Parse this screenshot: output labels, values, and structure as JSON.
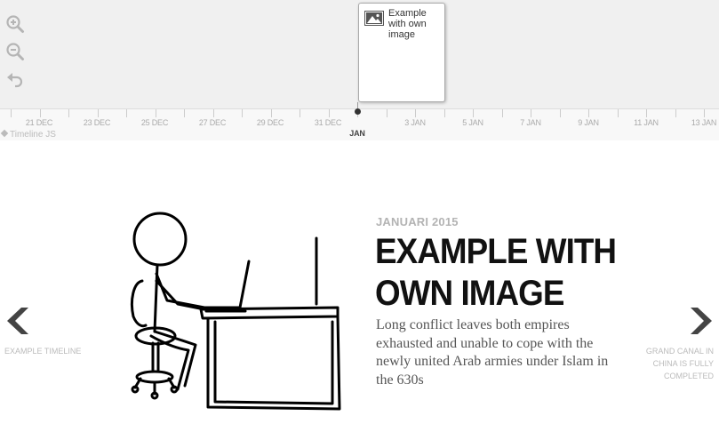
{
  "toolbar": {
    "zoom_in": "zoom-in-icon",
    "zoom_out": "zoom-out-icon",
    "back": "back-arrow-icon"
  },
  "marker": {
    "title": "Example with own image",
    "icon": "image-icon"
  },
  "timeline_axis": {
    "ticks": [
      "21 DEC",
      "23 DEC",
      "25 DEC",
      "27 DEC",
      "29 DEC",
      "31 DEC",
      "3 JAN",
      "5 JAN",
      "7 JAN",
      "9 JAN",
      "11 JAN",
      "13 JAN"
    ],
    "major_label": "JAN"
  },
  "credit": "Timeline JS",
  "slide": {
    "date": "JANUARI 2015",
    "title": "EXAMPLE WITH OWN IMAGE",
    "text": "Long conflict leaves both empires exhausted and unable to cope with the newly united Arab armies under Islam in the 630s",
    "image": "stick-figure-desk-drawing"
  },
  "navigation": {
    "prev_label": "EXAMPLE TIMELINE",
    "next_label": "GRAND CANAL IN CHINA IS FULLY COMPLETED",
    "prev_icon": "chevron-left-icon",
    "next_icon": "chevron-right-icon"
  }
}
